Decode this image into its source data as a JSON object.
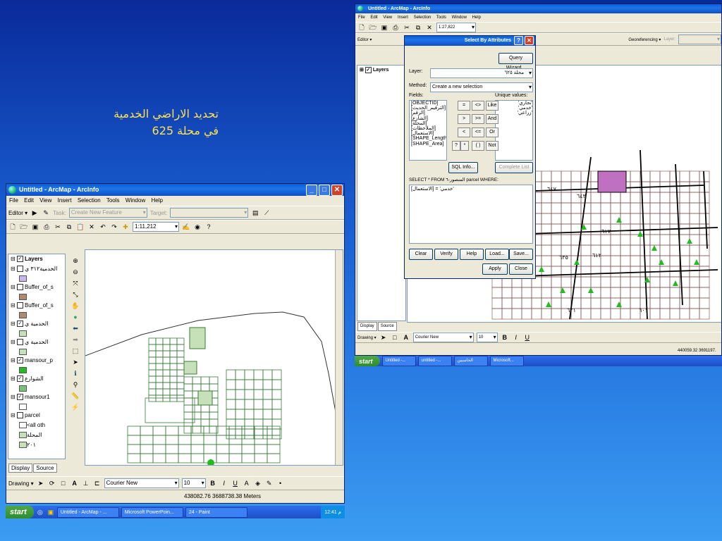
{
  "slide": {
    "title_line1": "تحديد الاراضي الخدمية",
    "title_line2": "في محلة 625"
  },
  "left_window": {
    "title": "Untitled - ArcMap - ArcInfo",
    "menu": [
      "File",
      "Edit",
      "View",
      "Insert",
      "Selection",
      "Tools",
      "Window",
      "Help"
    ],
    "editor_label": "Editor ▾",
    "task_label": "Task:",
    "task_value": "Create New Feature",
    "target_label": "Target:",
    "scale": "1:11,212",
    "toc": [
      {
        "name": "Layers",
        "checked": true,
        "kind": "group"
      },
      {
        "name": "الخدمية٣١٢ ي",
        "checked": false
      },
      {
        "name": "Buffer_of_s",
        "checked": false
      },
      {
        "name": "Buffer_of_s",
        "checked": false
      },
      {
        "name": "الخدمية ي",
        "checked": true
      },
      {
        "name": "الخدمية ي",
        "checked": false
      },
      {
        "name": "mansour_p",
        "checked": true
      },
      {
        "name": "الشوارع",
        "checked": true
      },
      {
        "name": "mansour1",
        "checked": true
      },
      {
        "name": "parcel",
        "checked": false
      },
      {
        "name": "<all oth",
        "checked": null
      },
      {
        "name": "المحلة",
        "checked": null
      },
      {
        "name": "٢٠١",
        "checked": null
      }
    ],
    "tabs": [
      "Display",
      "Source"
    ],
    "drawing_label": "Drawing ▾",
    "font_name": "Courier New",
    "font_size": "10",
    "coords": "438082.76  3688738.38 Meters",
    "taskbar": {
      "start": "start",
      "tasks": [
        "Untitled - ArcMap - ...",
        "Microsoft PowerPoin...",
        "24 - Paint"
      ],
      "clock": "12:41 م"
    }
  },
  "right_window": {
    "title": "Untitled - ArcMap - ArcInfo",
    "menu": [
      "File",
      "Edit",
      "View",
      "Insert",
      "Selection",
      "Tools",
      "Window",
      "Help"
    ],
    "scale": "1:27,822",
    "editor_label": "Editor ▾",
    "georef_label": "Georeferencing ▾",
    "layer_label": "Layer:",
    "toc_root": "Layers",
    "tabs": [
      "Display",
      "Source"
    ],
    "drawing_label": "Drawing ▾",
    "font_name": "Courier New",
    "font_size": "10",
    "coords": "440059.32  3691197.",
    "taskbar": {
      "start": "start",
      "tasks": [
        "Untitled -...",
        "untitled -...",
        "الحاسبين",
        "Microsoft..."
      ]
    },
    "map_labels": [
      "٦٤٧",
      "٦٤٣",
      "٦١٧",
      "٦٣٥",
      "٦١٢",
      "٦٢١",
      "٦٠١"
    ]
  },
  "dialog": {
    "title": "Select By Attributes",
    "query_wizard": "Query Wizard...",
    "layer_label": "Layer:",
    "layer_value": "محلة ٦٢٥",
    "method_label": "Method:",
    "method_value": "Create a new selection",
    "fields_label": "Fields:",
    "fields": [
      "[OBJECTID]",
      "[الترقيم_الحديث]",
      "[الرقم]",
      "[الشارع]",
      "[المحلة]",
      "[الملاحظات]",
      "[الاستعمال]",
      "[SHAPE_Length]",
      "[SHAPE_Area]"
    ],
    "unique_label": "Unique values:",
    "unique_values": [
      "'تجاري'",
      "'خدمي'",
      "'زراعي'"
    ],
    "operators": [
      "=",
      "<>",
      "Like",
      ">",
      ">=",
      "And",
      "<",
      "<=",
      "Or",
      "?",
      "*",
      "( )",
      "Not"
    ],
    "sql_info": "SQL Info...",
    "complete_list": "Complete List",
    "select_text": "SELECT * FROM المنصور-٦ parcel WHERE:",
    "expression": "[الاستعمال] = 'خدمي'",
    "buttons": [
      "Clear",
      "Verify",
      "Help",
      "Load...",
      "Save..."
    ],
    "apply": "Apply",
    "close": "Close"
  }
}
